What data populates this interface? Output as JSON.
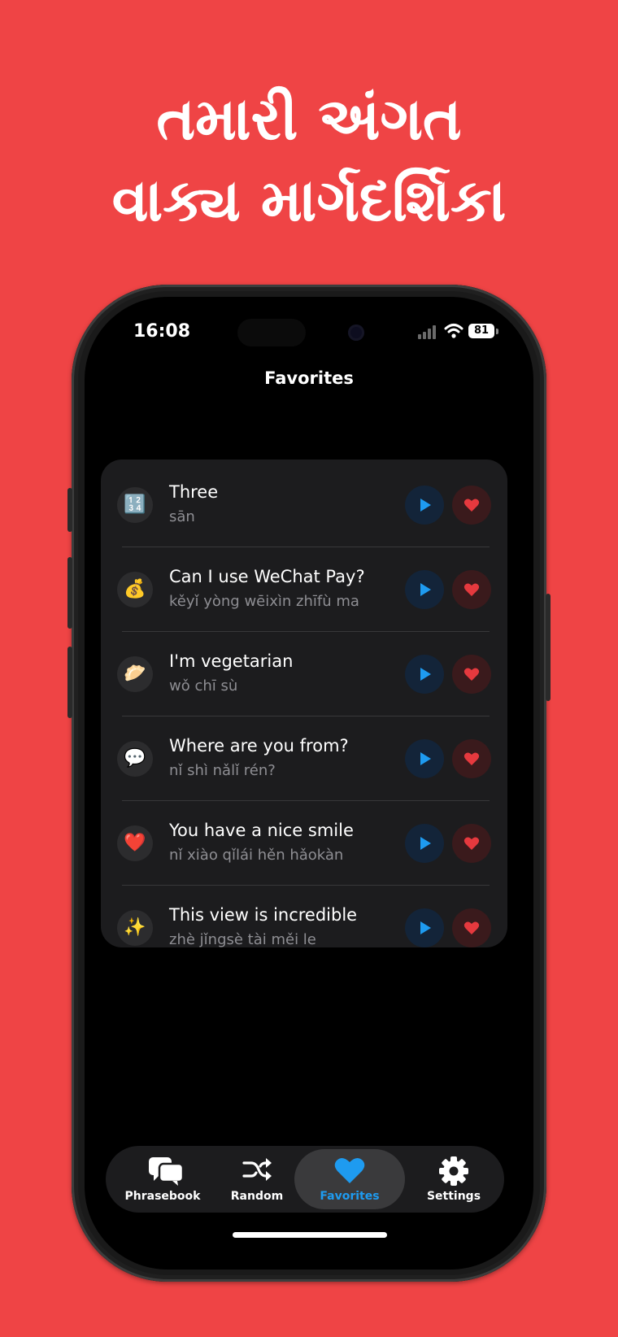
{
  "headline": {
    "line1": "તમારી અંગત",
    "line2": "વાક્ય માર્ગદર્શિકા"
  },
  "status_bar": {
    "time": "16:08",
    "battery": "81"
  },
  "nav": {
    "title": "Favorites"
  },
  "favorites": [
    {
      "emoji": "🔢",
      "emoji_icon": "input-numbers-icon",
      "phrase": "Three",
      "pinyin": "sān"
    },
    {
      "emoji": "💰",
      "emoji_icon": "money-bag-icon",
      "phrase": "Can I use WeChat Pay?",
      "pinyin": "kěyǐ yòng wēixìn zhīfù ma"
    },
    {
      "emoji": "🥟",
      "emoji_icon": "dumpling-icon",
      "phrase": "I'm vegetarian",
      "pinyin": "wǒ chī sù"
    },
    {
      "emoji": "💬",
      "emoji_icon": "speech-bubble-icon",
      "phrase": "Where are you from?",
      "pinyin": "nǐ shì nǎlǐ rén?"
    },
    {
      "emoji": "❤️",
      "emoji_icon": "red-heart-icon",
      "phrase": "You have a nice smile",
      "pinyin": "nǐ xiào qǐlái hěn hǎokàn"
    },
    {
      "emoji": "✨",
      "emoji_icon": "sparkles-icon",
      "phrase": "This view is incredible",
      "pinyin": "zhè jǐngsè tài měi le"
    }
  ],
  "tabs": [
    {
      "label": "Phrasebook",
      "icon": "speech-bubbles-icon",
      "selected": false
    },
    {
      "label": "Random",
      "icon": "shuffle-icon",
      "selected": false
    },
    {
      "label": "Favorites",
      "icon": "heart-icon",
      "selected": true
    },
    {
      "label": "Settings",
      "icon": "gear-icon",
      "selected": false
    }
  ],
  "colors": {
    "background": "#EF4445",
    "accent_blue": "#1E9BF0",
    "heart_red": "#E5393E"
  }
}
